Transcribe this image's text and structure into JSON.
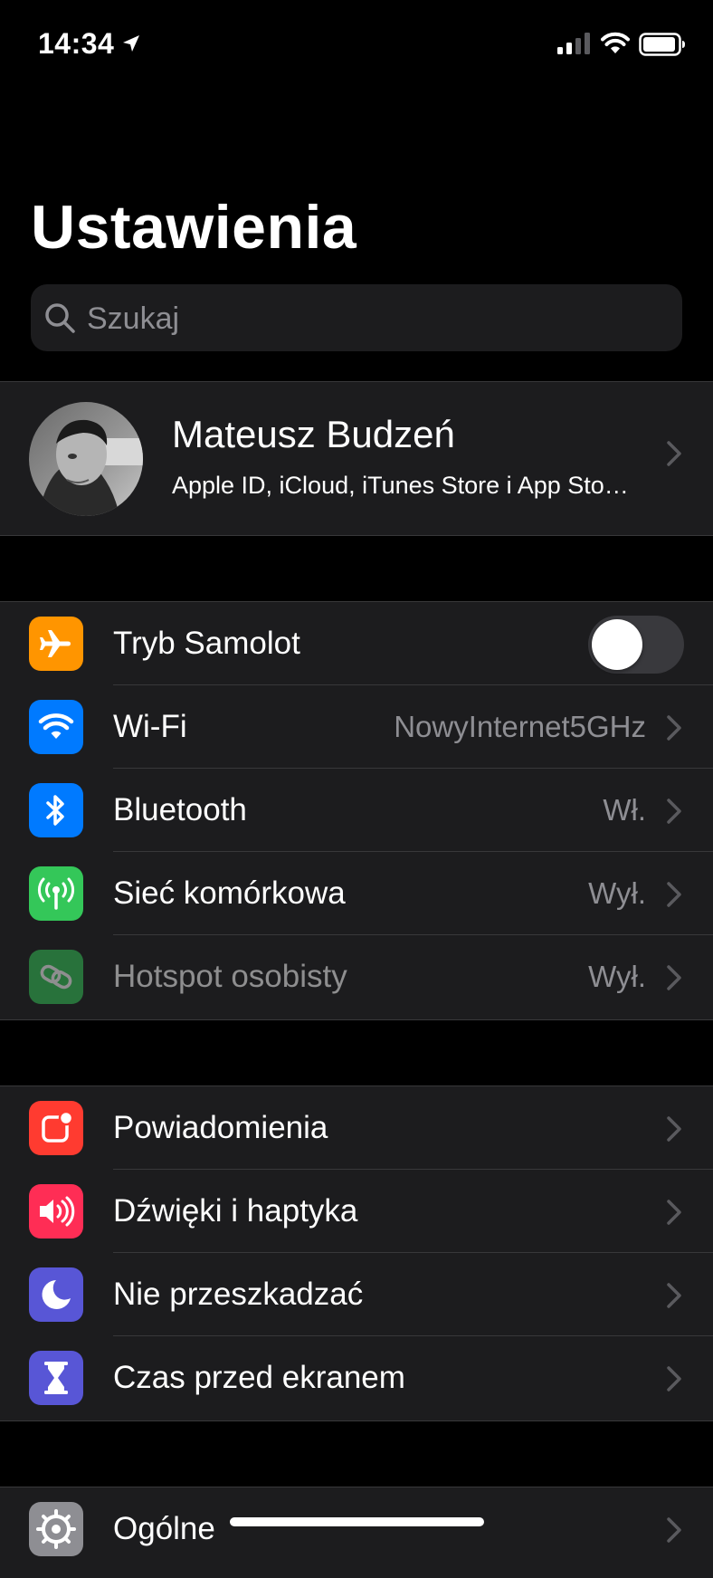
{
  "status": {
    "time": "14:34"
  },
  "title": "Ustawienia",
  "search": {
    "placeholder": "Szukaj"
  },
  "profile": {
    "name": "Mateusz Budzeń",
    "subtitle": "Apple ID, iCloud, iTunes Store i App Sto…"
  },
  "connectivity": [
    {
      "label": "Tryb Samolot",
      "icon": "airplane-icon",
      "color": "#ff9500",
      "toggle": false
    },
    {
      "label": "Wi-Fi",
      "value": "NowyInternet5GHz",
      "icon": "wifi-icon",
      "color": "#007aff"
    },
    {
      "label": "Bluetooth",
      "value": "Wł.",
      "icon": "bluetooth-icon",
      "color": "#007aff"
    },
    {
      "label": "Sieć komórkowa",
      "value": "Wył.",
      "icon": "cellular-antenna-icon",
      "color": "#34c759"
    },
    {
      "label": "Hotspot osobisty",
      "value": "Wył.",
      "icon": "hotspot-icon",
      "color": "#34c759",
      "disabled": true
    }
  ],
  "notifications": [
    {
      "label": "Powiadomienia",
      "icon": "notifications-icon",
      "color": "#ff3b30"
    },
    {
      "label": "Dźwięki i haptyka",
      "icon": "speaker-icon",
      "color": "#ff2d55"
    },
    {
      "label": "Nie przeszkadzać",
      "icon": "moon-icon",
      "color": "#5856d6"
    },
    {
      "label": "Czas przed ekranem",
      "icon": "hourglass-icon",
      "color": "#5856d6"
    }
  ],
  "general": [
    {
      "label": "Ogólne",
      "icon": "gear-icon",
      "color": "#8e8e93"
    }
  ]
}
